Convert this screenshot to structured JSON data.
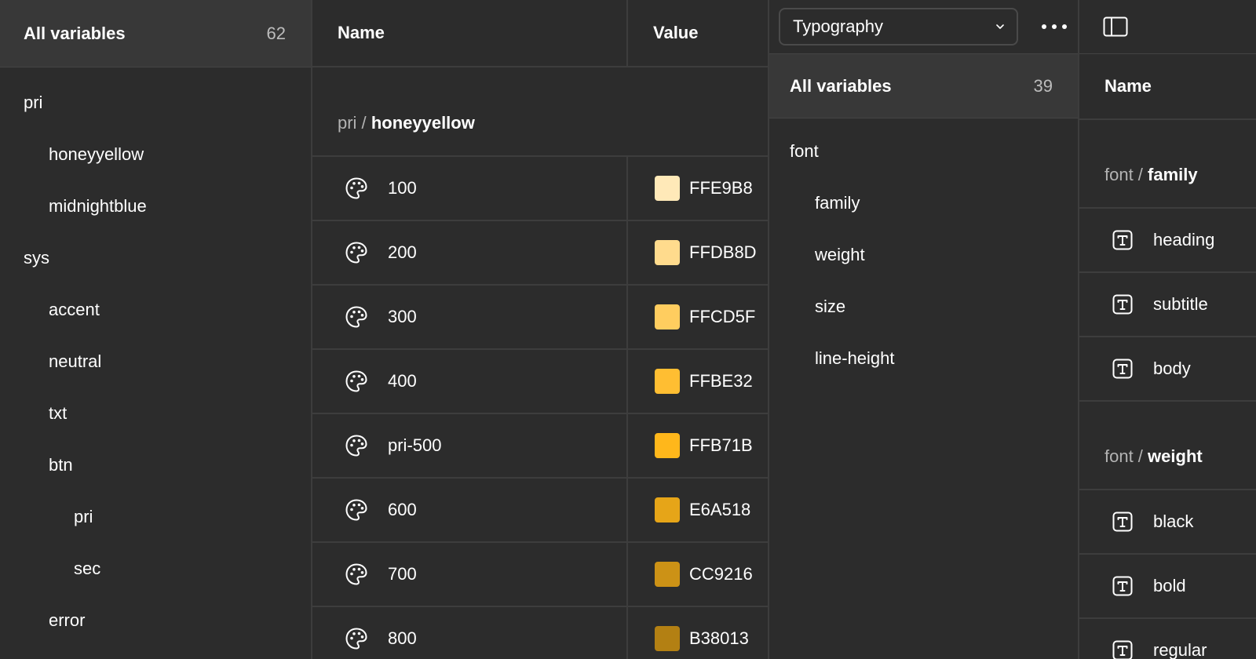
{
  "colors": {
    "background": "#2c2c2c",
    "header_bg": "#383838",
    "divider": "#3d3d3d"
  },
  "left_sidebar": {
    "title": "All variables",
    "count": "62",
    "items": [
      {
        "label": "pri",
        "level": 0
      },
      {
        "label": "honeyyellow",
        "level": 1
      },
      {
        "label": "midnightblue",
        "level": 1
      },
      {
        "label": "sys",
        "level": 0
      },
      {
        "label": "accent",
        "level": 1
      },
      {
        "label": "neutral",
        "level": 1
      },
      {
        "label": "txt",
        "level": 1
      },
      {
        "label": "btn",
        "level": 1
      },
      {
        "label": "pri",
        "level": 2
      },
      {
        "label": "sec",
        "level": 2
      },
      {
        "label": "error",
        "level": 1
      }
    ]
  },
  "main_table": {
    "col_name": "Name",
    "col_value": "Value",
    "group": {
      "prefix": "pri /",
      "name": "honeyyellow"
    },
    "rows": [
      {
        "name": "100",
        "value": "FFE9B8",
        "swatch": "#FFE9B8",
        "icon": "palette-icon"
      },
      {
        "name": "200",
        "value": "FFDB8D",
        "swatch": "#FFDB8D",
        "icon": "palette-icon"
      },
      {
        "name": "300",
        "value": "FFCD5F",
        "swatch": "#FFCD5F",
        "icon": "palette-icon"
      },
      {
        "name": "400",
        "value": "FFBE32",
        "swatch": "#FFBE32",
        "icon": "palette-icon"
      },
      {
        "name": "pri-500",
        "value": "FFB71B",
        "swatch": "#FFB71B",
        "icon": "palette-icon"
      },
      {
        "name": "600",
        "value": "E6A518",
        "swatch": "#E6A518",
        "icon": "palette-icon"
      },
      {
        "name": "700",
        "value": "CC9216",
        "swatch": "#CC9216",
        "icon": "palette-icon"
      },
      {
        "name": "800",
        "value": "B38013",
        "swatch": "#B38013",
        "icon": "palette-icon"
      }
    ]
  },
  "collection_panel": {
    "selected_collection": "Typography",
    "sidebar_title": "All variables",
    "sidebar_count": "39",
    "items": [
      {
        "label": "font",
        "level": 0
      },
      {
        "label": "family",
        "level": 1
      },
      {
        "label": "weight",
        "level": 1
      },
      {
        "label": "size",
        "level": 1
      },
      {
        "label": "line-height",
        "level": 1
      }
    ]
  },
  "right_table": {
    "col_name": "Name",
    "groups": [
      {
        "prefix": "font /",
        "name": "family",
        "rows": [
          "heading",
          "subtitle",
          "body"
        ]
      },
      {
        "prefix": "font /",
        "name": "weight",
        "rows": [
          "black",
          "bold",
          "regular"
        ]
      }
    ]
  }
}
